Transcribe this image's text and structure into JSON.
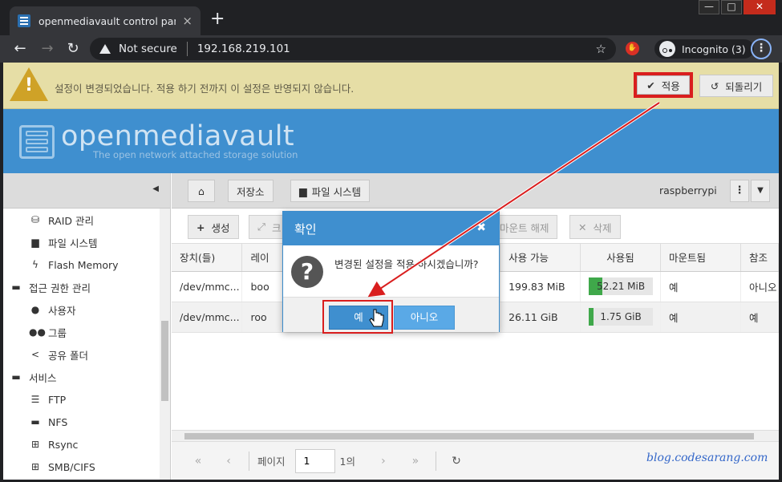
{
  "browser": {
    "tab_title": "openmediavault control panel - ",
    "tab_close": "×",
    "new_tab": "+",
    "win_min": "—",
    "win_max": "□",
    "win_close": "✕",
    "not_secure": "Not secure",
    "url": "192.168.219.101",
    "incognito": "Incognito (3)"
  },
  "notice": {
    "message": "설정이 변경되었습니다. 적용 하기 전까지 이 설정은 반영되지 않습니다.",
    "apply_label": "적용",
    "revert_label": "되돌리기"
  },
  "banner": {
    "title": "openmediavault",
    "subtitle": "The open network attached storage solution"
  },
  "sidebar": {
    "items": [
      {
        "label": "RAID 관리",
        "icon": "database-icon"
      },
      {
        "label": "파일 시스템",
        "icon": "folder-icon"
      },
      {
        "label": "Flash Memory",
        "icon": "bolt-icon"
      },
      {
        "label": "접근 권한 관리",
        "icon": "minus-square-icon"
      },
      {
        "label": "사용자",
        "icon": "user-icon"
      },
      {
        "label": "그룹",
        "icon": "users-icon"
      },
      {
        "label": "공유 폴더",
        "icon": "share-icon"
      },
      {
        "label": "서비스",
        "icon": "minus-square-icon"
      },
      {
        "label": "FTP",
        "icon": "server-icon"
      },
      {
        "label": "NFS",
        "icon": "desktop-icon"
      },
      {
        "label": "Rsync",
        "icon": "sitemap-icon"
      },
      {
        "label": "SMB/CIFS",
        "icon": "windows-icon"
      }
    ]
  },
  "breadcrumb": {
    "storage": "저장소",
    "filesystem": "파일 시스템",
    "hostname": "raspberrypi"
  },
  "toolbar": {
    "create": "생성",
    "resize": "크",
    "unmount": "마운트 해제",
    "delete": "삭제"
  },
  "table": {
    "headers": [
      "장치(들)",
      "레이",
      "",
      "",
      "사용 가능",
      "사용됨",
      "마운트됨",
      "참조"
    ],
    "rows": [
      {
        "device": "/dev/mmc...",
        "label": "boo",
        "available": "199.83 MiB",
        "used": "52.21 MiB",
        "used_pct": 0.21,
        "mounted": "예",
        "ref": "아니오"
      },
      {
        "device": "/dev/mmc...",
        "label": "roo",
        "available": "26.11 GiB",
        "used": "1.75 GiB",
        "used_pct": 0.07,
        "mounted": "예",
        "ref": "예"
      }
    ]
  },
  "pager": {
    "page_label": "페이지",
    "page_value": "1",
    "of_label": "1의"
  },
  "dialog": {
    "title": "확인",
    "message": "변경된 설정을 적용 하시겠습니까?",
    "yes": "예",
    "no": "아니오"
  },
  "watermark": "blog.codesarang.com",
  "colors": {
    "accent_blue": "#3f8fcf",
    "highlight_red": "#d91e1e",
    "notice_bg": "#e6dea6"
  }
}
